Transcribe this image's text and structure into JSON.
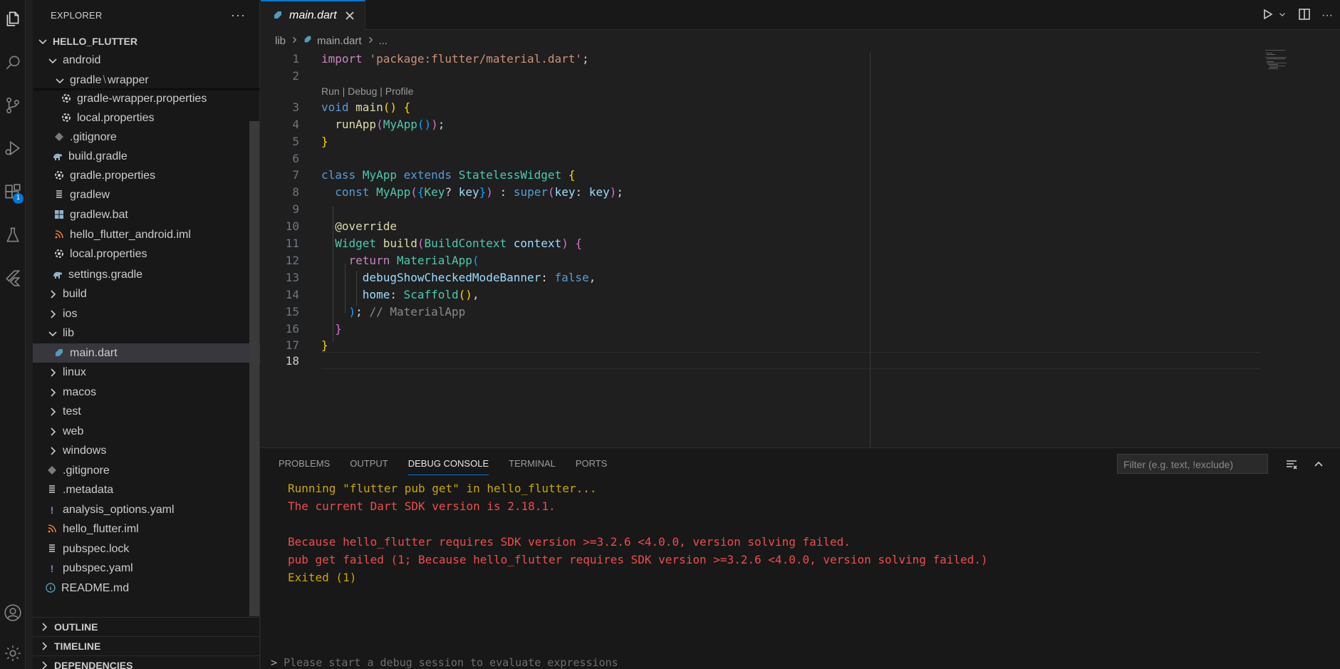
{
  "sidebar": {
    "title": "EXPLORER",
    "more": "···",
    "tree": [
      {
        "label": "HELLO_FLUTTER"
      },
      {
        "label": "android"
      },
      {
        "label": "gradle"
      },
      {
        "label": "wrapper"
      },
      {
        "label": "gradle-wrapper.properties"
      },
      {
        "label": "local.properties"
      },
      {
        "label": ".gitignore"
      },
      {
        "label": "build.gradle"
      },
      {
        "label": "gradle.properties"
      },
      {
        "label": "gradlew"
      },
      {
        "label": "gradlew.bat"
      },
      {
        "label": "hello_flutter_android.iml"
      },
      {
        "label": "local.properties"
      },
      {
        "label": "settings.gradle"
      },
      {
        "label": "build"
      },
      {
        "label": "ios"
      },
      {
        "label": "lib"
      },
      {
        "label": "main.dart"
      },
      {
        "label": "linux"
      },
      {
        "label": "macos"
      },
      {
        "label": "test"
      },
      {
        "label": "web"
      },
      {
        "label": "windows"
      },
      {
        "label": ".gitignore"
      },
      {
        "label": ".metadata"
      },
      {
        "label": "analysis_options.yaml"
      },
      {
        "label": "hello_flutter.iml"
      },
      {
        "label": "pubspec.lock"
      },
      {
        "label": "pubspec.yaml"
      },
      {
        "label": "README.md"
      }
    ],
    "sections": [
      {
        "label": "OUTLINE"
      },
      {
        "label": "TIMELINE"
      },
      {
        "label": "DEPENDENCIES"
      }
    ],
    "extensions_badge": "1"
  },
  "editor": {
    "tab_label": "main.dart",
    "breadcrumb": {
      "folder": "lib",
      "file": "main.dart",
      "more": "..."
    },
    "codelens": "Run | Debug | Profile",
    "line_numbers": [
      "1",
      "2",
      "3",
      "4",
      "5",
      "6",
      "7",
      "8",
      "9",
      "10",
      "11",
      "12",
      "13",
      "14",
      "15",
      "16",
      "17",
      "18"
    ]
  },
  "panel": {
    "tabs": [
      {
        "label": "PROBLEMS"
      },
      {
        "label": "OUTPUT"
      },
      {
        "label": "DEBUG CONSOLE"
      },
      {
        "label": "TERMINAL"
      },
      {
        "label": "PORTS"
      }
    ],
    "filter_placeholder": "Filter (e.g. text, !exclude)",
    "console_lines": [
      "Running \"flutter pub get\" in hello_flutter...",
      "The current Dart SDK version is 2.18.1.",
      "",
      "Because hello_flutter requires SDK version >=3.2.6 <4.0.0, version solving failed.",
      "pub get failed (1; Because hello_flutter requires SDK version >=3.2.6 <4.0.0, version solving failed.)",
      "Exited (1)"
    ],
    "prompt_text": "Please start a debug session to evaluate expressions"
  },
  "colors": {
    "accent": "#0078d4",
    "error": "#f14c4c",
    "warning": "#cca700",
    "dart": "#519aba"
  }
}
